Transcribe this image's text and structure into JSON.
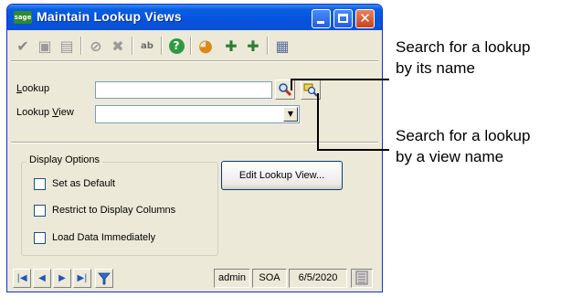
{
  "window": {
    "title": "Maintain Lookup Views",
    "app_badge": "sage"
  },
  "toolbar": {
    "items": [
      {
        "name": "accept-icon",
        "glyph": "✔",
        "color": "#8a8a8a"
      },
      {
        "name": "save-icon",
        "glyph": "▣",
        "color": "#9a9a9a"
      },
      {
        "name": "save-copy-icon",
        "glyph": "▤",
        "color": "#9a9a9a"
      },
      {
        "name": "cancel-icon",
        "glyph": "⊘",
        "color": "#9a9a9a"
      },
      {
        "name": "delete-icon",
        "glyph": "✖",
        "color": "#9a9a9a"
      },
      {
        "name": "lookup-text-icon",
        "glyph": "ab",
        "color": "#6a6a6a"
      },
      {
        "name": "help-icon",
        "glyph": "?",
        "color": "#2c8a3a"
      },
      {
        "name": "color-wheel-icon",
        "glyph": "◕",
        "color": "#d98a1b"
      },
      {
        "name": "export-icon",
        "glyph": "✚",
        "color": "#2e7d32"
      },
      {
        "name": "import-icon",
        "glyph": "✚",
        "color": "#2e7d32"
      },
      {
        "name": "calendar-icon",
        "glyph": "▦",
        "color": "#5a6e9a"
      }
    ]
  },
  "form": {
    "lookup_label_u": "L",
    "lookup_label_rest": "ookup",
    "lookup_value": "",
    "lookup_view_label_pre": "Lookup ",
    "lookup_view_label_u": "V",
    "lookup_view_label_rest": "iew",
    "lookup_view_value": ""
  },
  "display_options": {
    "legend": "Display Options",
    "checkboxes": [
      {
        "label": "Set as Default",
        "checked": false
      },
      {
        "label": "Restrict to Display Columns",
        "checked": false
      },
      {
        "label": "Load Data Immediately",
        "checked": false
      }
    ],
    "edit_button": "Edit Lookup View..."
  },
  "status": {
    "user": "admin",
    "company": "SOA",
    "date": "6/5/2020"
  },
  "callouts": {
    "top": {
      "line1": "Search for a lookup",
      "line2": "by its name"
    },
    "bottom": {
      "line1": "Search for a lookup",
      "line2": "by a view name"
    }
  }
}
